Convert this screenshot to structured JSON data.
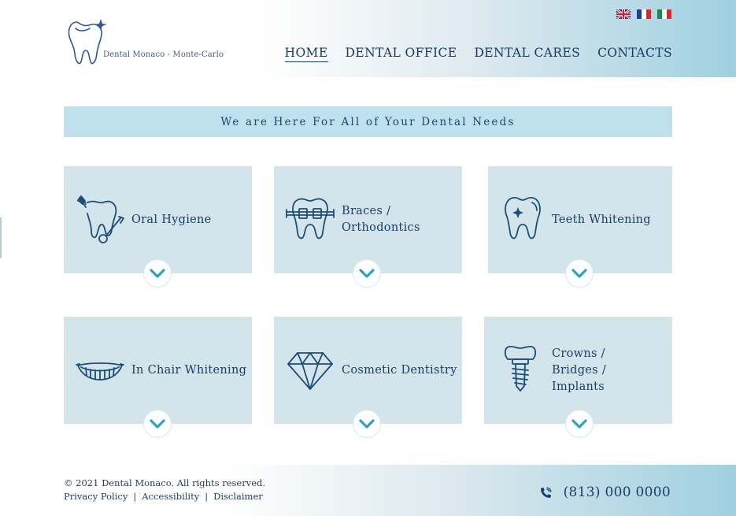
{
  "header": {
    "brand": "Dental Monaco - Monte-Carlo",
    "logo_icon": "tooth-sparkle-logo-icon",
    "flags": [
      {
        "name": "uk-flag-icon",
        "lang": "English"
      },
      {
        "name": "france-flag-icon",
        "lang": "French"
      },
      {
        "name": "italy-flag-icon",
        "lang": "Italian"
      }
    ],
    "nav": [
      {
        "label": "HOME",
        "active": true
      },
      {
        "label": "DENTAL OFFICE",
        "active": false
      },
      {
        "label": "DENTAL CARES",
        "active": false
      },
      {
        "label": "CONTACTS",
        "active": false
      }
    ]
  },
  "banner": {
    "text": "We are Here For All of Your Dental Needs"
  },
  "services": [
    {
      "label": "Oral Hygiene",
      "icon": "tooth-mirror-brush-icon"
    },
    {
      "label": "Braces / Orthodontics",
      "icon": "tooth-braces-icon"
    },
    {
      "label": "Teeth Whitening",
      "icon": "tooth-sparkle-icon"
    },
    {
      "label": "In Chair Whitening",
      "icon": "smile-teeth-icon"
    },
    {
      "label": "Cosmetic Dentistry",
      "icon": "diamond-icon"
    },
    {
      "label": "Crowns / Bridges / Implants",
      "icon": "dental-implant-icon"
    }
  ],
  "footer": {
    "copyright": "© 2021 Dental Monaco. All rights reserved.",
    "links": [
      "Privacy Policy",
      "Accessibility",
      "Disclaimer"
    ],
    "separator": "|",
    "phone": "(813) 000 0000",
    "phone_icon": "phone-icon"
  },
  "colors": {
    "primary": "#1b3d6b",
    "card": "#d4e4eb",
    "banner": "#bfe1ee",
    "accent": "#2aa3c4"
  }
}
